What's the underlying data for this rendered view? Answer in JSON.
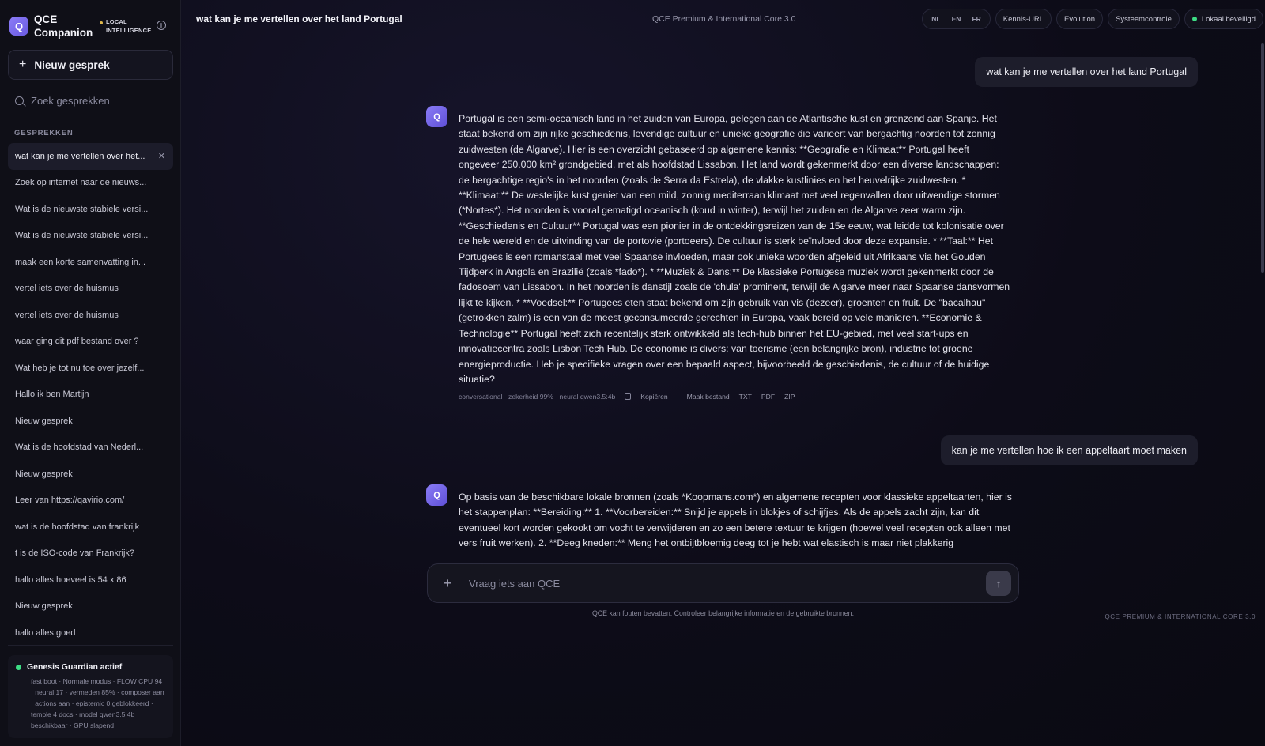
{
  "brand": {
    "logo_letter": "Q",
    "name": "QCE Companion",
    "tag": "LOCAL INTELLIGENCE",
    "info_glyph": "i"
  },
  "sidebar": {
    "new_chat_label": "Nieuw gesprek",
    "search_placeholder": "Zoek gesprekken",
    "section_label": "GESPREKKEN",
    "conversations": [
      "wat kan je me vertellen over het...",
      "Zoek op internet naar de nieuws...",
      "Wat is de nieuwste stabiele versi...",
      "Wat is de nieuwste stabiele versi...",
      "maak een korte samenvatting in...",
      "vertel iets over de huismus",
      "vertel iets over de huismus",
      "waar ging dit pdf bestand over ?",
      "Wat heb je tot nu toe over jezelf...",
      "Hallo ik ben Martijn",
      "Nieuw gesprek",
      "Wat is de hoofdstad van Nederl...",
      "Nieuw gesprek",
      "Leer van https://qavirio.com/",
      "wat is de hoofdstad van frankrijk",
      "t is de ISO-code van Frankrijk?",
      "hallo alles hoeveel is 54 x 86",
      "Nieuw gesprek",
      "hallo alles goed"
    ],
    "active_index": 0,
    "guardian": {
      "title": "Genesis Guardian actief",
      "detail": "fast boot · Normale modus · FLOW CPU 94 · neural 17 · vermeden 85% · composer aan · actions aan · epistemic 0 geblokkeerd · temple 4 docs · model qwen3.5:4b beschikbaar · GPU slapend"
    }
  },
  "topbar": {
    "title": "wat kan je me vertellen over het land Portugal",
    "model": "QCE Premium & International Core 3.0",
    "languages": [
      "NL",
      "EN",
      "FR"
    ],
    "buttons": [
      "Kennis-URL",
      "Evolution",
      "Systeemcontrole"
    ],
    "status": "Lokaal beveiligd"
  },
  "chat": {
    "messages": [
      {
        "user": "wat kan je me vertellen over het land Portugal",
        "assistant": "Portugal is een semi-oceanisch land in het zuiden van Europa, gelegen aan de Atlantische kust en grenzend aan Spanje. Het staat bekend om zijn rijke geschiedenis, levendige cultuur en unieke geografie die varieert van bergachtig noorden tot zonnig zuidwesten (de Algarve). Hier is een overzicht gebaseerd op algemene kennis: **Geografie en Klimaat** Portugal heeft ongeveer 250.000 km² grondgebied, met als hoofdstad Lissabon. Het land wordt gekenmerkt door een diverse landschappen: de bergachtige regio's in het noorden (zoals de Serra da Estrela), de vlakke kustlinies en het heuvelrijke zuidwesten. * **Klimaat:** De westelijke kust geniet van een mild, zonnig mediterraan klimaat met veel regenvallen door uitwendige stormen (*Nortes*). Het noorden is vooral gematigd oceanisch (koud in winter), terwijl het zuiden en de Algarve zeer warm zijn. **Geschiedenis en Cultuur** Portugal was een pionier in de ontdekkingsreizen van de 15e eeuw, wat leidde tot kolonisatie over de hele wereld en de uitvinding van de portovie (portoeers). De cultuur is sterk beïnvloed door deze expansie. * **Taal:** Het Portugees is een romanstaal met veel Spaanse invloeden, maar ook unieke woorden afgeleid uit Afrikaans via het Gouden Tijdperk in Angola en Brazilië (zoals *fado*). * **Muziek & Dans:** De klassieke Portugese muziek wordt gekenmerkt door de fadosoem van Lissabon. In het noorden is danstijl zoals de 'chula' prominent, terwijl de Algarve meer naar Spaanse dansvormen lijkt te kijken. * **Voedsel:** Portugees eten staat bekend om zijn gebruik van vis (dezeer), groenten en fruit. De \"bacalhau\" (getrokken zalm) is een van de meest geconsumeerde gerechten in Europa, vaak bereid op vele manieren. **Economie & Technologie** Portugal heeft zich recentelijk sterk ontwikkeld als tech-hub binnen het EU-gebied, met veel start-ups en innovatiecentra zoals Lisbon Tech Hub. De economie is divers: van toerisme (een belangrijke bron), industrie tot groene energieproductie. Heb je specifieke vragen over een bepaald aspect, bijvoorbeeld de geschiedenis, de cultuur of de huidige situatie?",
        "meta": "conversational · zekerheid 99% · neural qwen3.5:4b",
        "actions": [
          "Kopiëren",
          "Maak bestand",
          "TXT",
          "PDF",
          "ZIP"
        ]
      },
      {
        "user": "kan je me vertellen hoe ik een appeltaart moet maken",
        "assistant": "Op basis van de beschikbare lokale bronnen (zoals *Koopmans.com*) en algemene recepten voor klassieke appeltaarten, hier is het stappenplan: **Bereiding:** 1. **Voorbereiden:** Snijd je appels in blokjes of schijfjes. Als de appels zacht zijn, kan dit eventueel kort worden gekookt om vocht te verwijderen en zo een betere textuur te krijgen (hoewel veel recepten ook alleen met vers fruit werken). 2. **Deeg kneden:** Meng het ontbijtbloemig deeg tot je hebt wat elastisch is maar niet plakkerig"
      }
    ],
    "avatar_letter": "Q"
  },
  "composer": {
    "placeholder": "Vraag iets aan QCE",
    "add_glyph": "+",
    "send_glyph": "↑",
    "disclaimer": "QCE kan fouten bevatten. Controleer belangrijke informatie en de gebruikte bronnen."
  },
  "footer": {
    "brand": "QCE PREMIUM & INTERNATIONAL CORE 3.0"
  },
  "colors": {
    "accent": "#7b6cf0",
    "status_green": "#3ddc84",
    "background": "#0b0b14"
  }
}
